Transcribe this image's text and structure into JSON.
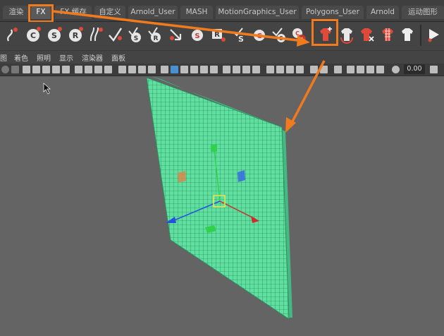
{
  "shelf_tabs": [
    {
      "label": "渲染"
    },
    {
      "label": "FX"
    },
    {
      "label": "FX 缓存"
    },
    {
      "label": "自定义"
    },
    {
      "label": "Arnold_User"
    },
    {
      "label": "MASH"
    },
    {
      "label": "MotionGraphics_User"
    },
    {
      "label": "Polygons_User"
    },
    {
      "label": "Arnold"
    },
    {
      "label": "运动图形"
    }
  ],
  "active_tab": "FX",
  "menus": [
    "图",
    "着色",
    "照明",
    "显示",
    "渲染器",
    "面板"
  ],
  "toolbar": {
    "zoom_value": "0.00"
  },
  "colors": {
    "highlight": "#f07a1e",
    "mesh": "#5fe0a0",
    "active_tab_bg": "#5a5a5a"
  },
  "shelf_icons": [
    "ncloth-s-curve-icon",
    "nucleus-c-icon",
    "nucleus-s-icon",
    "nhair-r-icon",
    "hair-strands-icon",
    "hair-check-icon",
    "hair-s-icon",
    "hair-r-icon",
    "hair-arrow-icon",
    "fluid-s-icon",
    "rigid-r-icon",
    "constraint-s-check-icon",
    "constraint-c-icon",
    "constraint-s-icon",
    "constraint-cr-icon",
    "create-ncloth-icon",
    "ncloth-rest-icon",
    "ncloth-remove-icon",
    "ncloth-mesh-icon",
    "ncloth-white-icon",
    "play-icon"
  ]
}
